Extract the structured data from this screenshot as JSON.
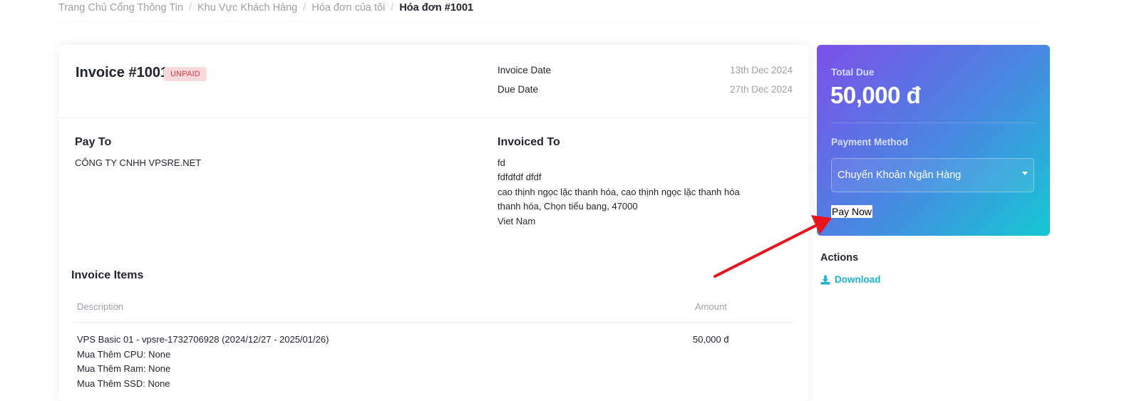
{
  "breadcrumb": {
    "items": [
      "Trang Chủ Cổng Thông Tin",
      "Khu Vực Khách Hàng",
      "Hóa đơn của tôi"
    ],
    "separator": "/",
    "current": "Hóa đơn #1001"
  },
  "invoice": {
    "title": "Invoice #1001",
    "status": "UNPAID",
    "invoice_date_label": "Invoice Date",
    "invoice_date": "13th Dec 2024",
    "due_date_label": "Due Date",
    "due_date": "27th Dec 2024"
  },
  "pay_to": {
    "title": "Pay To",
    "lines": [
      "CÔNG TY CNHH VPSRE.NET"
    ]
  },
  "invoiced_to": {
    "title": "Invoiced To",
    "lines": [
      "fd",
      "fdfdfdf dfdf",
      "cao thịnh ngọc lặc thanh hóa, cao thịnh ngọc lặc thanh hóa",
      "thanh hóa, Chọn tiểu bang, 47000",
      "Viet Nam"
    ]
  },
  "items": {
    "title": "Invoice Items",
    "columns": [
      "Description",
      "Amount"
    ],
    "rows": [
      {
        "description_lines": [
          "VPS Basic 01 - vpsre-1732706928 (2024/12/27 - 2025/01/26)",
          "Mua Thêm CPU: None",
          "Mua Thêm Ram: None",
          "Mua Thêm SSD: None"
        ],
        "amount": "50,000 đ"
      }
    ]
  },
  "payment": {
    "total_due_label": "Total Due",
    "total_due": "50,000 đ",
    "method_label": "Payment Method",
    "method_selected": "Chuyển Khoản Ngân Hàng",
    "pay_now_label": "Pay Now"
  },
  "actions": {
    "title": "Actions",
    "download_label": "Download",
    "download_icon": "download-icon"
  },
  "colors": {
    "accent": "#1fb3d2",
    "badge_bg": "#f9d9db",
    "badge_text": "#d63545",
    "gradient_start": "#7d50e8",
    "gradient_end": "#16c7d4",
    "annotation_arrow": "#e8141c"
  }
}
